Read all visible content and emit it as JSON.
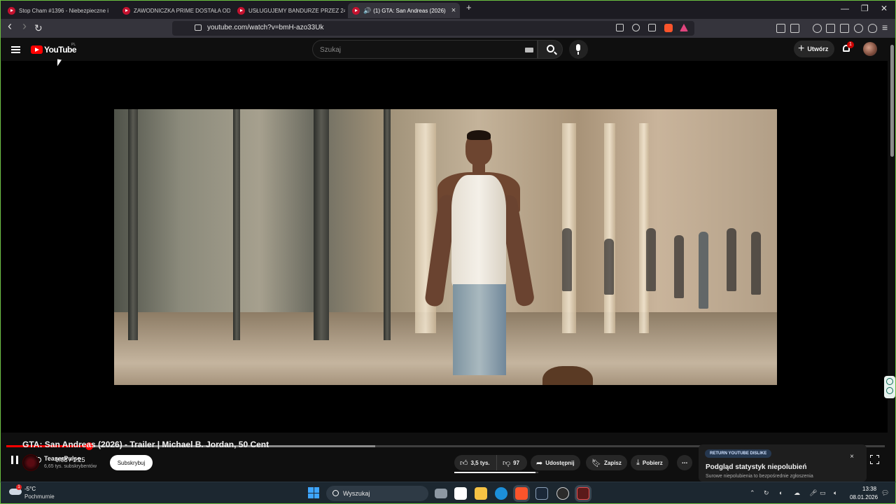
{
  "browser": {
    "tabs": [
      {
        "title": "Stop Cham #1396 - Niebezpieczne i",
        "active": false
      },
      {
        "title": "ZAWODNICZKA PRIME DOSTAŁA OD",
        "active": false
      },
      {
        "title": "USŁUGUJEMY BANDURZE PRZEZ 24!",
        "active": false
      },
      {
        "title": "(1) GTA: San Andreas (2026)",
        "active": true
      }
    ],
    "tab_close": "×",
    "new_tab": "+",
    "window_controls": {
      "minimize": "—",
      "maximize": "❐",
      "close": "✕"
    },
    "url": "youtube.com/watch?v=bmH-azo33Uk",
    "nav": {
      "back": "‹",
      "forward": "›",
      "reload": "↻"
    }
  },
  "masthead": {
    "logo_text": "YouTube",
    "country_code": "PL",
    "search_placeholder": "Szukaj",
    "create_label": "Utwórz",
    "create_icon": "+",
    "notifications_count": "1"
  },
  "player": {
    "progress": {
      "played_fraction": 0.094,
      "buffered_fraction": 0.42
    },
    "time_current": "0:08",
    "time_total": "1:25",
    "time_display": "0:08 / 1:25",
    "hd_badge": "HD"
  },
  "video": {
    "title": "GTA: San Andreas (2026) - Trailer | Michael B. Jordan, 50 Cent",
    "channel_name": "TeaserPulse",
    "channel_subs": "6,65 tys. subskrybentów",
    "subscribe_label": "Subskrybuj",
    "actions": {
      "likes": "3,5 tys.",
      "dislikes": "97",
      "share": "Udostępnij",
      "save": "Zapisz",
      "download": "Pobierz",
      "more": "⋯"
    },
    "like_ratio": 0.97
  },
  "dislike_panel": {
    "tag": "RETURN YOUTUBE DISLIKE",
    "heading": "Podgląd statystyk niepolubień",
    "subtext": "Surowe niepolubienia to bezpośrednie zgłoszenia",
    "close": "×"
  },
  "taskbar": {
    "weather_temp": "-5°C",
    "weather_condition": "Pochmurnie",
    "weather_badge": "1",
    "search_label": "Wyszukaj",
    "time": "13:38",
    "date": "08.01.2026"
  },
  "colors": {
    "accent": "#ff0000",
    "background": "#0f0f0f",
    "window_border": "#6abf40"
  }
}
